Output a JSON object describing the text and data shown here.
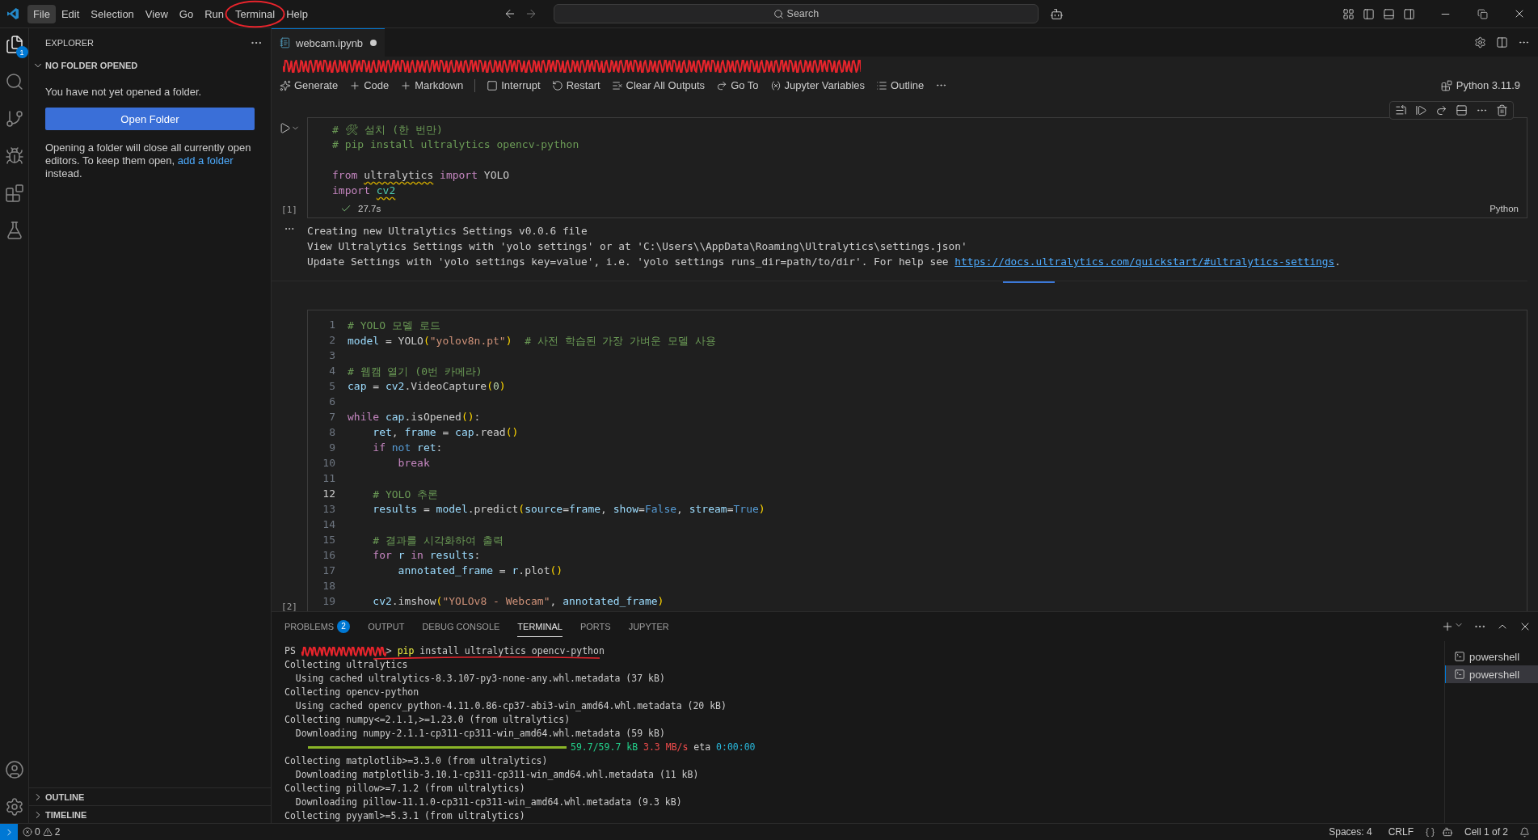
{
  "title_bar": {
    "menu": [
      {
        "label": "File",
        "selected": true,
        "circled": false
      },
      {
        "label": "Edit",
        "selected": false,
        "circled": false
      },
      {
        "label": "Selection",
        "selected": false,
        "circled": false
      },
      {
        "label": "View",
        "selected": false,
        "circled": false
      },
      {
        "label": "Go",
        "selected": false,
        "circled": false
      },
      {
        "label": "Run",
        "selected": false,
        "circled": false
      },
      {
        "label": "Terminal",
        "selected": false,
        "circled": true
      },
      {
        "label": "Help",
        "selected": false,
        "circled": false
      }
    ],
    "search": {
      "placeholder": "Search"
    }
  },
  "activity_bar": {
    "explorer_badge": "1"
  },
  "sidebar": {
    "title": "EXPLORER",
    "section": {
      "label": "NO FOLDER OPENED",
      "expanded": true
    },
    "message": "You have not yet opened a folder.",
    "button": "Open Folder",
    "note": {
      "text": "Opening a folder will close all currently open editors. To keep them open, ",
      "link": "add a folder",
      "after": " instead."
    },
    "bottom_sections": [
      {
        "label": "OUTLINE",
        "expanded": false
      },
      {
        "label": "TIMELINE",
        "expanded": false
      }
    ]
  },
  "editor": {
    "tabs": [
      {
        "label": "webcam.ipynb",
        "modified": true,
        "selected": true
      }
    ],
    "breadcrumb": {
      "redacted": true
    },
    "toolbar": [
      "Generate",
      "Code",
      "Markdown",
      "Interrupt",
      "Restart",
      "Clear All Outputs",
      "Go To",
      "Jupyter Variables",
      "Outline"
    ],
    "kernel": "Python 3.11.9",
    "cells": [
      {
        "execution_count": "[1]",
        "succeeded": true,
        "duration": "27.7s",
        "language": "Python",
        "lines": [
          {
            "tokens": [
              {
                "text": "# 🛠 설치 (한 번만)",
                "kind": "comment"
              }
            ]
          },
          {
            "tokens": [
              {
                "text": "# pip install ultralytics opencv-python",
                "kind": "comment"
              }
            ]
          },
          {
            "kind": "blank"
          },
          {
            "tokens": [
              {
                "text": "from ",
                "kind": "keyword"
              },
              {
                "text": "ultralytics",
                "kind": "plain",
                "squiggle": true
              },
              {
                "text": " import",
                "kind": "keyword"
              },
              {
                "text": " YOLO",
                "kind": "plain"
              }
            ]
          },
          {
            "tokens": [
              {
                "text": "import ",
                "kind": "keyword"
              },
              {
                "text": "cv2",
                "kind": "module",
                "squiggle": true
              }
            ]
          }
        ],
        "output": [
          {
            "text": "Creating new Ultralytics Settings v0.0.6 file"
          },
          {
            "text": "View Ultralytics Settings with 'yolo settings' or at 'C:\\Users\\\\AppData\\Roaming\\Ultralytics\\settings.json'"
          },
          {
            "text": "Update Settings with 'yolo settings key=value', i.e. 'yolo settings runs_dir=path/to/dir'. For help see ",
            "link": "https://docs.ultralytics.com/quickstart/#ultralytics-settings",
            "after": "."
          }
        ]
      },
      {
        "execution_count": "[2]",
        "lines": [
          {
            "number": "1",
            "tokens": [
              {
                "text": "# YOLO 모델 로드",
                "kind": "comment"
              }
            ]
          },
          {
            "number": "2",
            "tokens": [
              {
                "text": "model",
                "kind": "variable"
              },
              {
                "text": " = YOLO",
                "kind": "plain"
              },
              {
                "text": "(",
                "kind": "bracket"
              },
              {
                "text": "\"yolov8n.pt\"",
                "kind": "string"
              },
              {
                "text": ")",
                "kind": "bracket"
              },
              {
                "text": "  # 사전 학습된 가장 가벼운 모델 사용",
                "kind": "comment"
              }
            ]
          },
          {
            "number": "3"
          },
          {
            "number": "4",
            "tokens": [
              {
                "text": "# 웹캠 열기 (0번 카메라)",
                "kind": "comment"
              }
            ]
          },
          {
            "number": "5",
            "tokens": [
              {
                "text": "cap",
                "kind": "variable"
              },
              {
                "text": " = ",
                "kind": "plain"
              },
              {
                "text": "cv2",
                "kind": "variable"
              },
              {
                "text": ".VideoCapture",
                "kind": "plain"
              },
              {
                "text": "(",
                "kind": "bracket"
              },
              {
                "text": "0",
                "kind": "number"
              },
              {
                "text": ")",
                "kind": "bracket"
              }
            ]
          },
          {
            "number": "6"
          },
          {
            "number": "7",
            "tokens": [
              {
                "text": "while ",
                "kind": "keyword"
              },
              {
                "text": "cap",
                "kind": "variable"
              },
              {
                "text": ".isOpened",
                "kind": "plain"
              },
              {
                "text": "()",
                "kind": "bracket"
              },
              {
                "text": ":",
                "kind": "plain"
              }
            ]
          },
          {
            "number": "8",
            "tokens": [
              {
                "text": "    ret",
                "kind": "variable"
              },
              {
                "text": ", ",
                "kind": "plain"
              },
              {
                "text": "frame",
                "kind": "variable"
              },
              {
                "text": " = ",
                "kind": "plain"
              },
              {
                "text": "cap",
                "kind": "variable"
              },
              {
                "text": ".read",
                "kind": "plain"
              },
              {
                "text": "()",
                "kind": "bracket"
              }
            ]
          },
          {
            "number": "9",
            "tokens": [
              {
                "text": "    if ",
                "kind": "keyword"
              },
              {
                "text": "not ",
                "kind": "constant"
              },
              {
                "text": "ret",
                "kind": "variable"
              },
              {
                "text": ":",
                "kind": "plain"
              }
            ]
          },
          {
            "number": "10",
            "tokens": [
              {
                "text": "        break",
                "kind": "keyword"
              }
            ]
          },
          {
            "number": "11"
          },
          {
            "number": "12",
            "current": true,
            "tokens": [
              {
                "text": "    # YOLO 추론",
                "kind": "comment"
              }
            ]
          },
          {
            "number": "13",
            "tokens": [
              {
                "text": "    results",
                "kind": "variable"
              },
              {
                "text": " = ",
                "kind": "plain"
              },
              {
                "text": "model",
                "kind": "variable"
              },
              {
                "text": ".predict",
                "kind": "plain"
              },
              {
                "text": "(",
                "kind": "bracket"
              },
              {
                "text": "source",
                "kind": "variable"
              },
              {
                "text": "=",
                "kind": "plain"
              },
              {
                "text": "frame",
                "kind": "variable"
              },
              {
                "text": ", ",
                "kind": "plain"
              },
              {
                "text": "show",
                "kind": "variable"
              },
              {
                "text": "=",
                "kind": "plain"
              },
              {
                "text": "False",
                "kind": "constant"
              },
              {
                "text": ", ",
                "kind": "plain"
              },
              {
                "text": "stream",
                "kind": "variable"
              },
              {
                "text": "=",
                "kind": "plain"
              },
              {
                "text": "True",
                "kind": "constant"
              },
              {
                "text": ")",
                "kind": "bracket"
              }
            ]
          },
          {
            "number": "14"
          },
          {
            "number": "15",
            "tokens": [
              {
                "text": "    # 결과를 시각화하여 출력",
                "kind": "comment"
              }
            ]
          },
          {
            "number": "16",
            "tokens": [
              {
                "text": "    for ",
                "kind": "keyword"
              },
              {
                "text": "r ",
                "kind": "variable"
              },
              {
                "text": "in ",
                "kind": "keyword"
              },
              {
                "text": "results",
                "kind": "variable"
              },
              {
                "text": ":",
                "kind": "plain"
              }
            ]
          },
          {
            "number": "17",
            "tokens": [
              {
                "text": "        annotated_frame",
                "kind": "variable"
              },
              {
                "text": " = ",
                "kind": "plain"
              },
              {
                "text": "r",
                "kind": "variable"
              },
              {
                "text": ".plot",
                "kind": "plain"
              },
              {
                "text": "()",
                "kind": "bracket"
              }
            ]
          },
          {
            "number": "18"
          },
          {
            "number": "19",
            "tokens": [
              {
                "text": "    cv2",
                "kind": "variable"
              },
              {
                "text": ".imshow",
                "kind": "plain"
              },
              {
                "text": "(",
                "kind": "bracket"
              },
              {
                "text": "\"YOLOv8 - Webcam\"",
                "kind": "string"
              },
              {
                "text": ", ",
                "kind": "plain"
              },
              {
                "text": "annotated_frame",
                "kind": "variable"
              },
              {
                "text": ")",
                "kind": "bracket"
              }
            ]
          }
        ]
      }
    ]
  },
  "panel": {
    "tabs": [
      {
        "label": "PROBLEMS",
        "badge": "2",
        "selected": false
      },
      {
        "label": "OUTPUT",
        "selected": false
      },
      {
        "label": "DEBUG CONSOLE",
        "selected": false
      },
      {
        "label": "TERMINAL",
        "selected": true
      },
      {
        "label": "PORTS",
        "selected": false
      },
      {
        "label": "JUPYTER",
        "selected": false
      }
    ],
    "terminal": [
      {
        "underlined": true,
        "segments": [
          {
            "text": "PS ",
            "kind": "plain"
          },
          {
            "kind": "redacted"
          },
          {
            "text": "> ",
            "kind": "plain"
          },
          {
            "text": "pip",
            "kind": "command"
          },
          {
            "text": " install ultralytics opencv-python",
            "kind": "plain"
          }
        ]
      },
      {
        "segments": [
          {
            "text": "Collecting ultralytics",
            "kind": "plain"
          }
        ]
      },
      {
        "segments": [
          {
            "text": "  Using cached ultralytics-8.3.107-py3-none-any.whl.metadata (37 kB)",
            "kind": "plain"
          }
        ]
      },
      {
        "segments": [
          {
            "text": "Collecting opencv-python",
            "kind": "plain"
          }
        ]
      },
      {
        "segments": [
          {
            "text": "  Using cached opencv_python-4.11.0.86-cp37-abi3-win_amd64.whl.metadata (20 kB)",
            "kind": "plain"
          }
        ]
      },
      {
        "segments": [
          {
            "text": "Collecting numpy<=2.1.1,>=1.23.0 (from ultralytics)",
            "kind": "plain"
          }
        ]
      },
      {
        "segments": [
          {
            "text": "  Downloading numpy-2.1.1-cp311-cp311-win_amd64.whl.metadata (59 kB)",
            "kind": "plain"
          }
        ]
      },
      {
        "segments": [
          {
            "kind": "progress",
            "level": 1
          },
          {
            "text": "59.7/59.7 kB",
            "kind": "green"
          },
          {
            "text": " 3.3 MB/s",
            "kind": "red"
          },
          {
            "text": " eta ",
            "kind": "plain"
          },
          {
            "text": "0:00:00",
            "kind": "cyan"
          }
        ]
      },
      {
        "segments": [
          {
            "text": "Collecting matplotlib>=3.3.0 (from ultralytics)",
            "kind": "plain"
          }
        ]
      },
      {
        "segments": [
          {
            "text": "  Downloading matplotlib-3.10.1-cp311-cp311-win_amd64.whl.metadata (11 kB)",
            "kind": "plain"
          }
        ]
      },
      {
        "segments": [
          {
            "text": "Collecting pillow>=7.1.2 (from ultralytics)",
            "kind": "plain"
          }
        ]
      },
      {
        "segments": [
          {
            "text": "  Downloading pillow-11.1.0-cp311-cp311-win_amd64.whl.metadata (9.3 kB)",
            "kind": "plain"
          }
        ]
      },
      {
        "segments": [
          {
            "text": "Collecting pyyaml>=5.3.1 (from ultralytics)",
            "kind": "plain"
          }
        ]
      }
    ],
    "terminals": [
      {
        "label": "powershell",
        "selected": false
      },
      {
        "label": "powershell",
        "selected": true
      }
    ]
  },
  "status_bar": {
    "errors": "0",
    "warnings": "2",
    "items": [
      "Spaces: 4",
      "CRLF",
      "Cell 1 of 2"
    ]
  }
}
